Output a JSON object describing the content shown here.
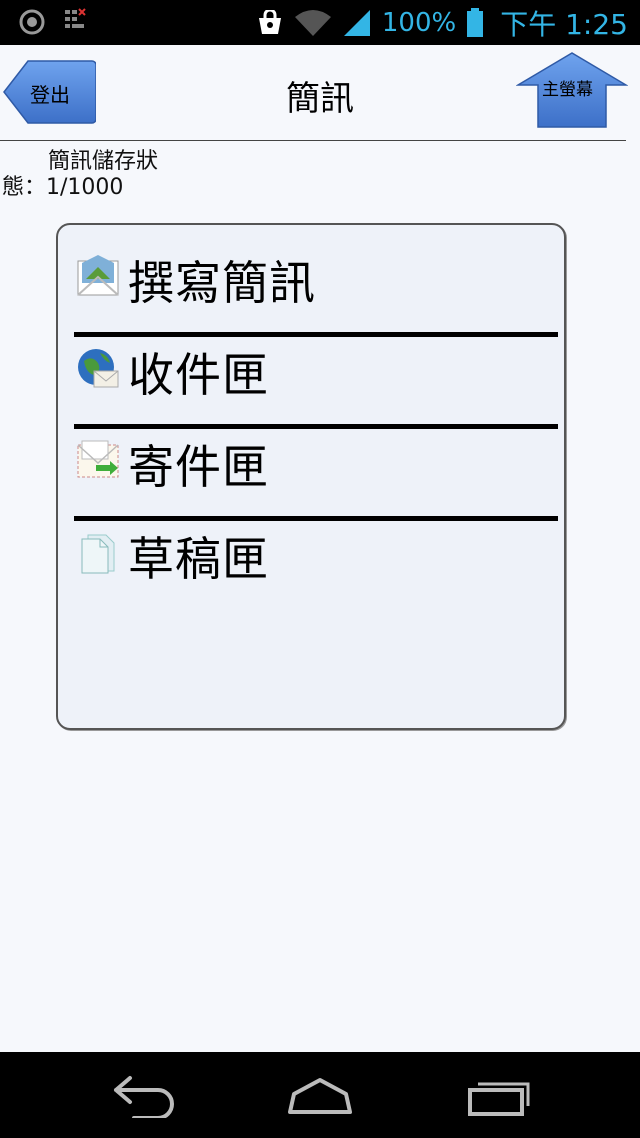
{
  "status_bar": {
    "battery_percent": "100%",
    "time": "下午 1:25",
    "icons": [
      "compass-icon",
      "keypad-notification-icon",
      "shopping-bag-icon",
      "wifi-icon",
      "signal-icon",
      "battery-icon"
    ]
  },
  "header": {
    "title": "簡訊",
    "logout_label": "登出",
    "home_label": "主螢幕"
  },
  "storage": {
    "label_line1": "簡訊儲存狀",
    "label_line2": "態：1/1000"
  },
  "menu": {
    "items": [
      {
        "label": "撰寫簡訊",
        "icon": "compose-envelope-icon"
      },
      {
        "label": "收件匣",
        "icon": "inbox-globe-icon"
      },
      {
        "label": "寄件匣",
        "icon": "sent-envelope-icon"
      },
      {
        "label": "草稿匣",
        "icon": "draft-document-icon"
      }
    ]
  },
  "navbar": {
    "icons": [
      "back-icon",
      "home-icon",
      "recent-apps-icon"
    ]
  },
  "colors": {
    "accent": "#33b5e5",
    "button_blue": "#4a7fd4",
    "background": "#f6f8fc"
  }
}
